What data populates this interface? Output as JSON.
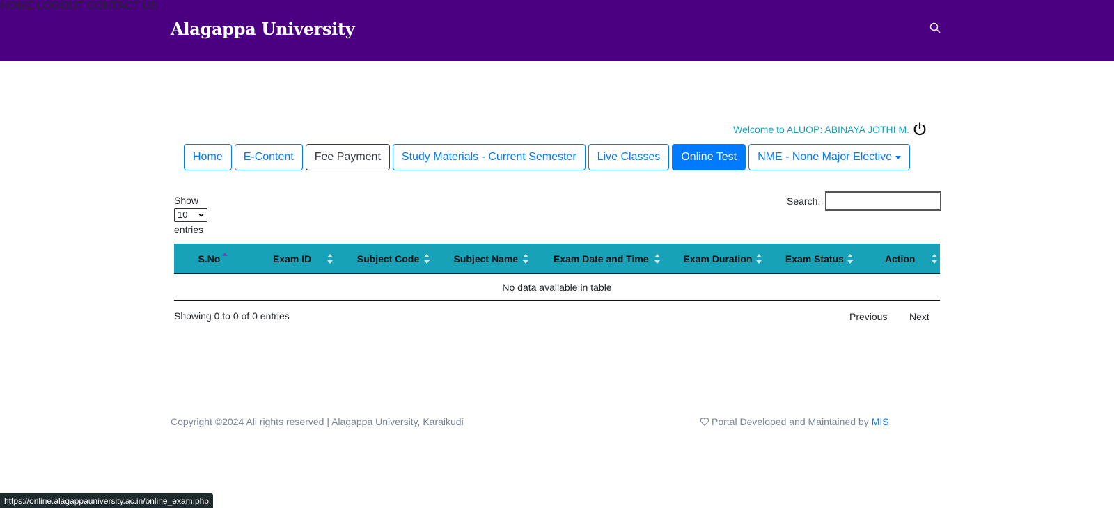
{
  "header": {
    "brand": "Alagappa University",
    "nav": [
      {
        "label": "HOME"
      },
      {
        "label": "LOGOUT"
      },
      {
        "label": "CONTACT US"
      }
    ]
  },
  "welcome": {
    "text": "Welcome to ALUOP: ABINAYA JOTHI M."
  },
  "tabs": [
    {
      "label": "Home",
      "state": "normal"
    },
    {
      "label": "E-Content",
      "state": "normal"
    },
    {
      "label": "Fee Payment",
      "state": "dark"
    },
    {
      "label": "Study Materials - Current Semester",
      "state": "normal"
    },
    {
      "label": "Live Classes",
      "state": "normal"
    },
    {
      "label": "Online Test",
      "state": "active"
    },
    {
      "label": "NME - None Major Elective",
      "state": "dropdown"
    }
  ],
  "table_controls": {
    "show_label": "Show",
    "entries_label": "entries",
    "page_length": "10",
    "search_label": "Search:",
    "search_value": ""
  },
  "table": {
    "columns": [
      "S.No",
      "Exam ID",
      "Subject Code",
      "Subject Name",
      "Exam Date and Time",
      "Exam Duration",
      "Exam Status",
      "Action"
    ],
    "empty_message": "No data available in table"
  },
  "pagination": {
    "info": "Showing 0 to 0 of 0 entries",
    "previous": "Previous",
    "next": "Next"
  },
  "footer": {
    "copyright": "Copyright ©2024 All rights reserved | Alagappa University, Karaikudi",
    "developed_by": "Portal Developed and Maintained by",
    "developer": "MIS"
  },
  "statusbar": {
    "url": "https://online.alagappauniversity.ac.in/online_exam.php"
  },
  "colors": {
    "header_bg": "#4b0082",
    "primary": "#007bff",
    "table_header": "#17a2b8",
    "welcome_text": "#17a2b8"
  }
}
